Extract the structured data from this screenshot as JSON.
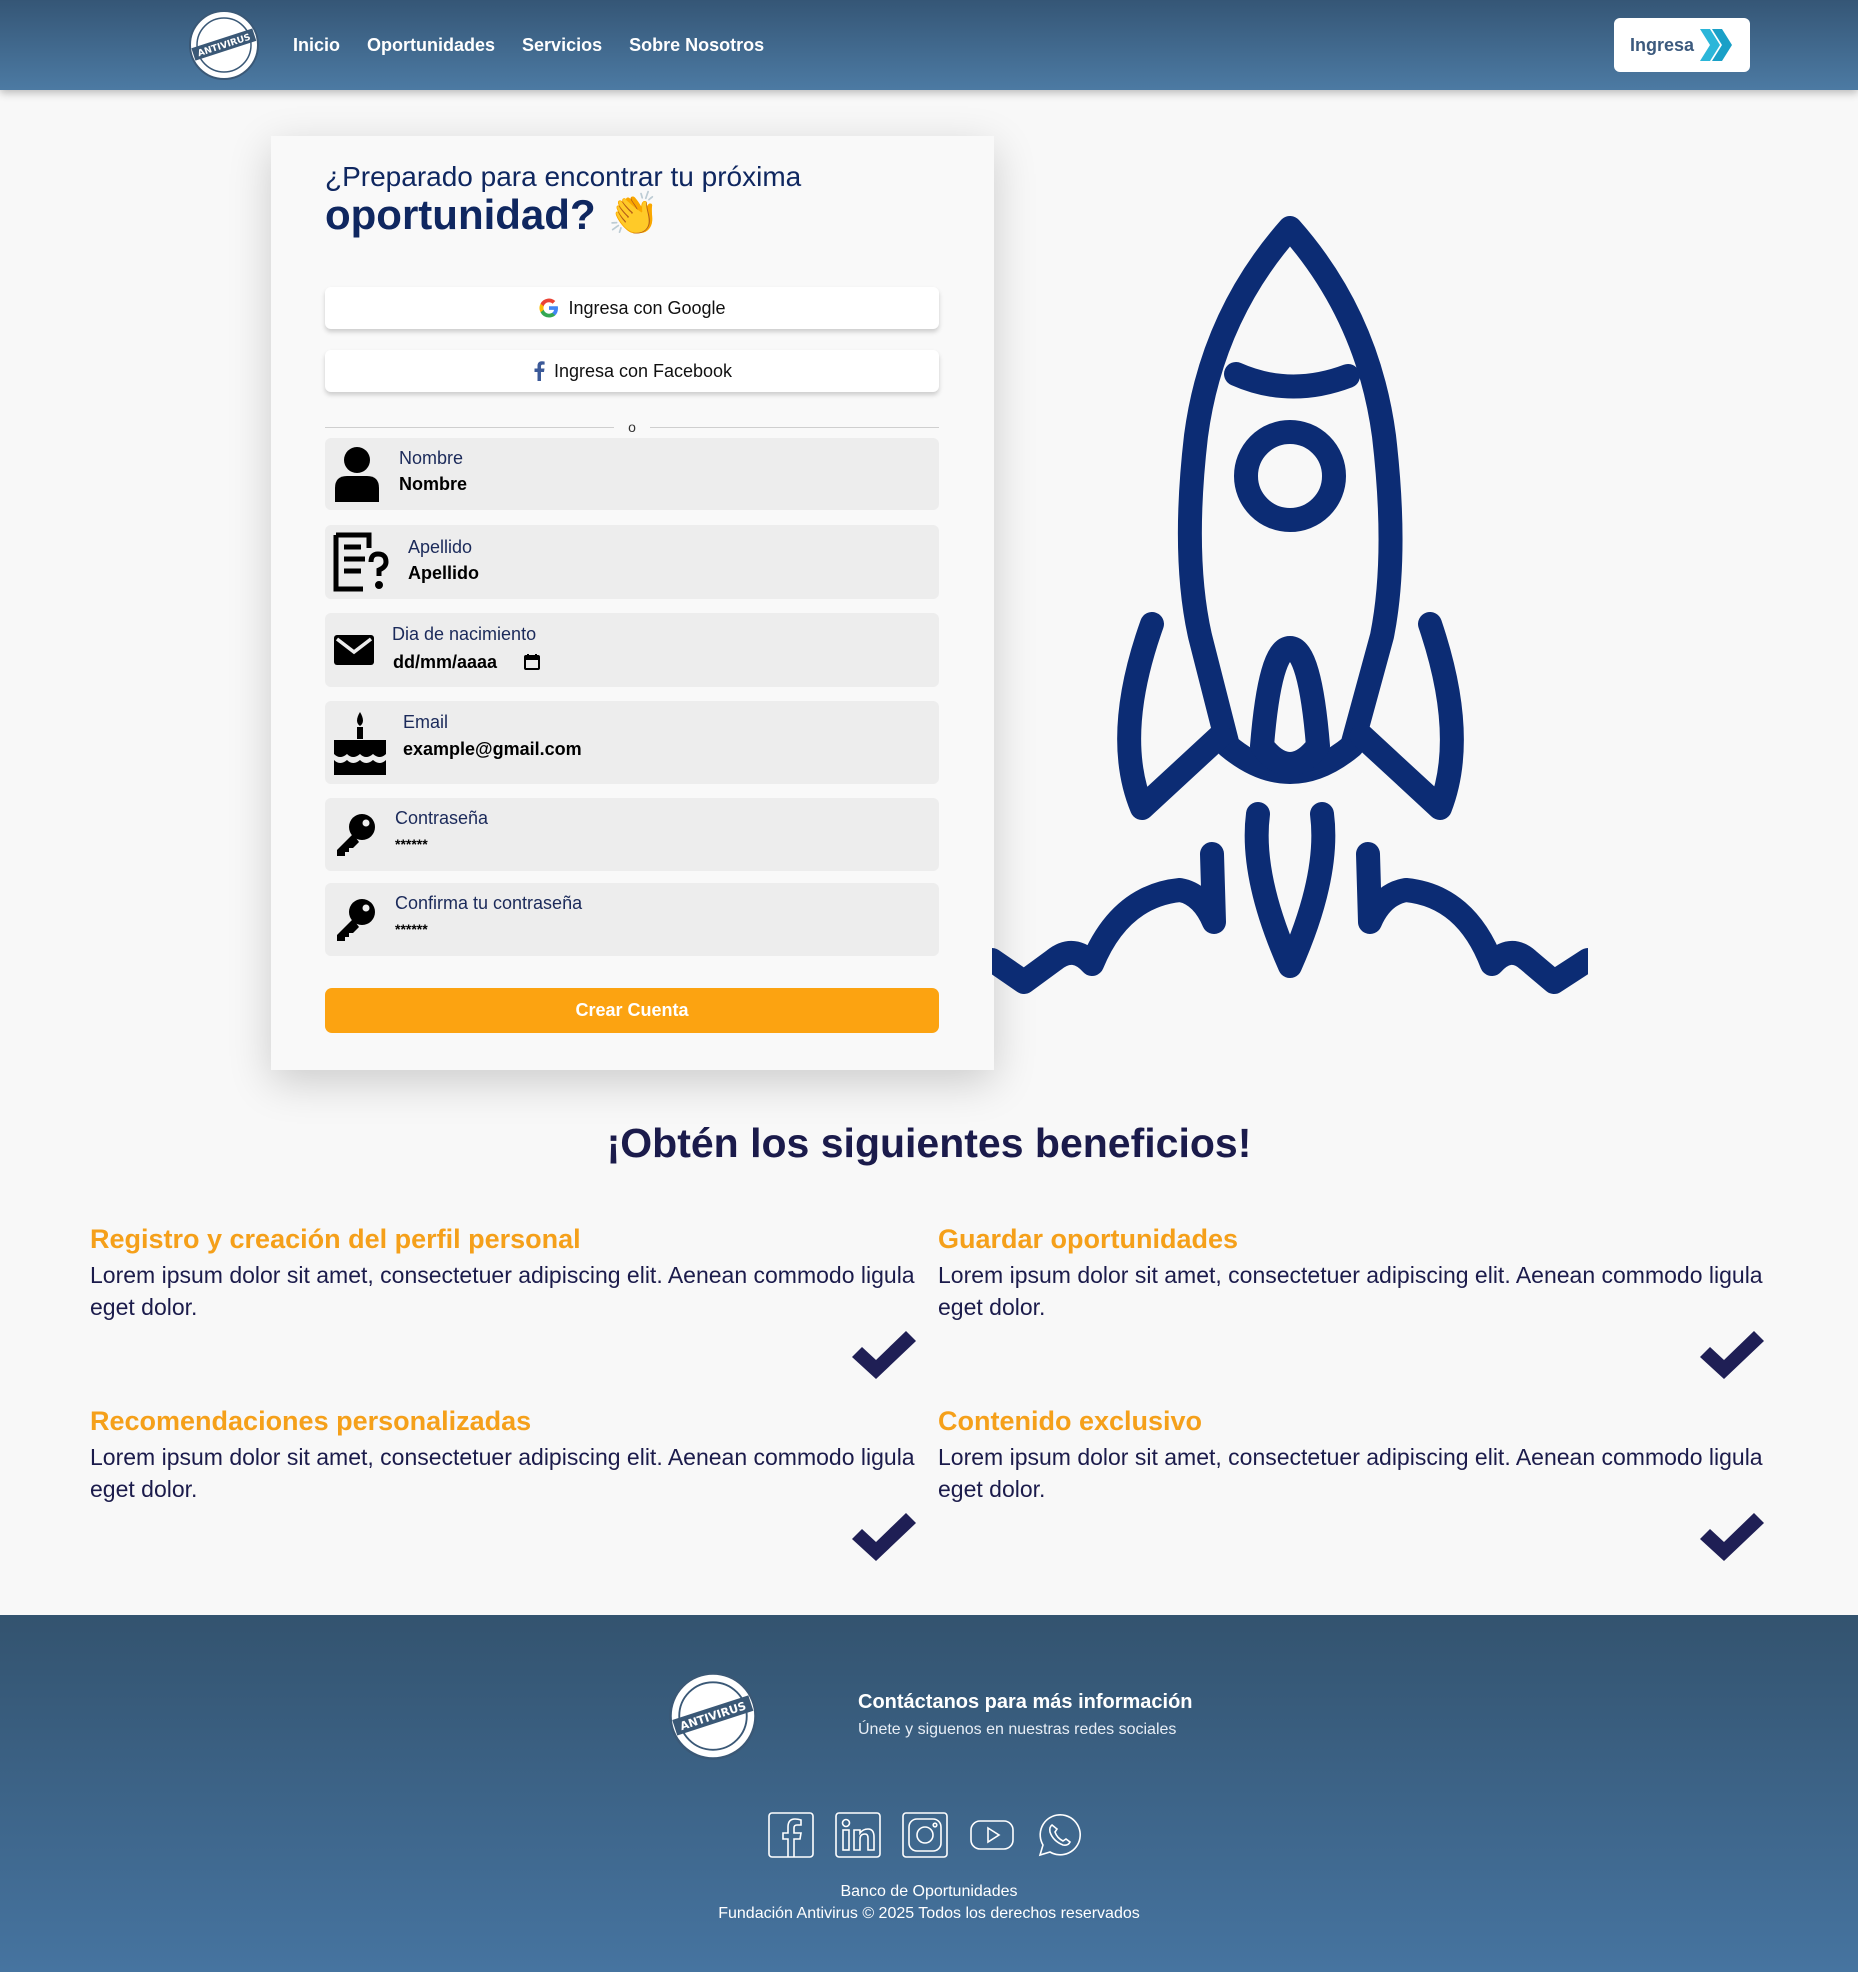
{
  "nav": {
    "links": [
      "Inicio",
      "Oportunidades",
      "Servicios",
      "Sobre Nosotros"
    ],
    "login_label": "Ingresa",
    "logo_icon": "fundacion-antivirus-logo",
    "accent": "#4c7aa3"
  },
  "form": {
    "greeting": "¿Preparado para encontrar tu próxima",
    "greeting_big": "oportunidad?",
    "greeting_emoji": "👏",
    "google_label": "Ingresa con Google",
    "facebook_label": "Ingresa con Facebook",
    "divider": "o",
    "fields": [
      {
        "label": "Nombre",
        "value": "Nombre",
        "icon": "user-icon"
      },
      {
        "label": "Apellido",
        "value": "Apellido",
        "icon": "document-question-icon"
      },
      {
        "label": "Dia de nacimiento",
        "value": "dd/mm/aaaa",
        "icon": "envelope-icon"
      },
      {
        "label": "Email",
        "value": "example@gmail.com",
        "icon": "birthday-cake-icon"
      },
      {
        "label": "Contraseña",
        "value": "******",
        "icon": "key-icon"
      },
      {
        "label": "Confirma tu contraseña",
        "value": "******",
        "icon": "key-icon"
      }
    ],
    "submit_label": "Crear Cuenta",
    "submit_color": "#fca311"
  },
  "benefits": {
    "title": "¡Obtén los siguientes beneficios!",
    "items": [
      {
        "title": "Registro y creación del perfil personal",
        "text": "Lorem ipsum dolor sit amet, consectetuer adipiscing elit. Aenean commodo ligula eget dolor."
      },
      {
        "title": "Guardar oportunidades",
        "text": "Lorem ipsum dolor sit amet, consectetuer adipiscing elit. Aenean commodo ligula eget dolor."
      },
      {
        "title": "Recomendaciones personalizadas",
        "text": "Lorem ipsum dolor sit amet, consectetuer adipiscing elit. Aenean commodo ligula eget dolor."
      },
      {
        "title": "Contenido exclusivo",
        "text": "Lorem ipsum dolor sit amet, consectetuer adipiscing elit. Aenean commodo ligula eget dolor."
      }
    ],
    "title_color": "#f5a01a"
  },
  "footer": {
    "contact_title": "Contáctanos para más información",
    "contact_sub": "Únete y siguenos en nuestras redes sociales",
    "socials": [
      "facebook-icon",
      "linkedin-icon",
      "instagram-icon",
      "youtube-icon",
      "whatsapp-icon"
    ],
    "line1": "Banco de Oportunidades",
    "line2": "Fundación Antivirus © 2025 Todos los derechos reservados"
  }
}
